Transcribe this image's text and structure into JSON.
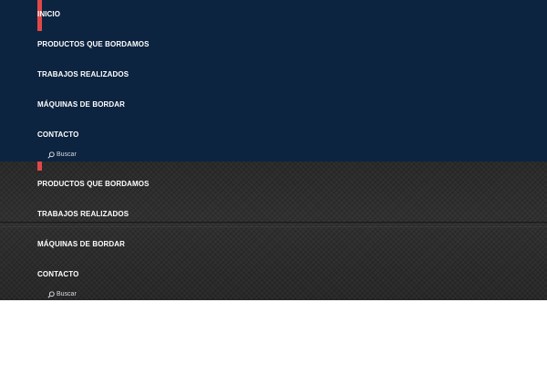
{
  "menu_top": {
    "items": [
      {
        "label": "INICIO",
        "active": true
      },
      {
        "label": "PRODUCTOS QUE BORDAMOS"
      },
      {
        "label": "TRABAJOS REALIZADOS"
      },
      {
        "label": "MÁQUINAS DE BORDAR"
      },
      {
        "label": "CONTACTO"
      }
    ],
    "search_label": "Buscar"
  },
  "menu_bottom": {
    "items": [
      {
        "label": "PRODUCTOS QUE BORDAMOS"
      },
      {
        "label": "TRABAJOS REALIZADOS"
      },
      {
        "label": "MÁQUINAS DE BORDAR"
      },
      {
        "label": "CONTACTO"
      }
    ],
    "search_label": "Buscar"
  },
  "colors": {
    "nav_background": "#0d2440",
    "accent": "#e04848",
    "text": "#ffffff"
  }
}
